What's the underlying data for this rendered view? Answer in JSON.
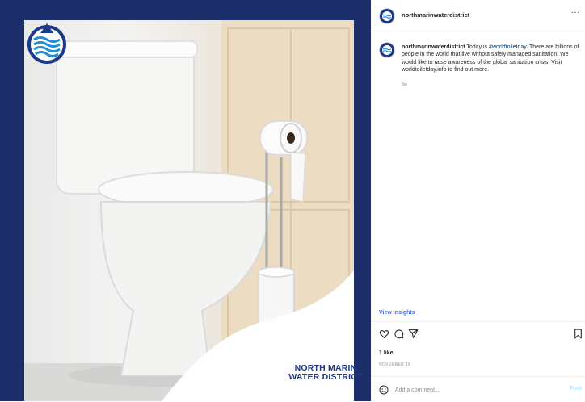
{
  "post": {
    "brand_logo_lines": [
      "NORTH MARIN",
      "WATER DISTRICT"
    ],
    "brand_color": "#1d3a8a"
  },
  "header": {
    "username": "northmarinwaterdistrict",
    "more_label": "···"
  },
  "caption": {
    "username": "northmarinwaterdistrict",
    "text_before_tag": " Today is ",
    "hashtag": "#worldtoiletday",
    "text_after_tag": ". There are billions of people in the world that live without safely managed sanitation. We would like to raise awareness of the global sanitation crisis. Visit worldtoiletday.info to find out more.",
    "age": "3w"
  },
  "insights_label": "View Insights",
  "actions": {
    "icons": [
      "heart-icon",
      "comment-icon",
      "share-icon",
      "bookmark-icon"
    ]
  },
  "likes": "1 like",
  "date": "NOVEMBER 19",
  "comment": {
    "placeholder": "Add a comment...",
    "post_label": "Post"
  },
  "colors": {
    "frame": "#1c2f6b",
    "link": "#00376b",
    "insights": "#4b70d9",
    "muted": "#8e8e8e"
  }
}
